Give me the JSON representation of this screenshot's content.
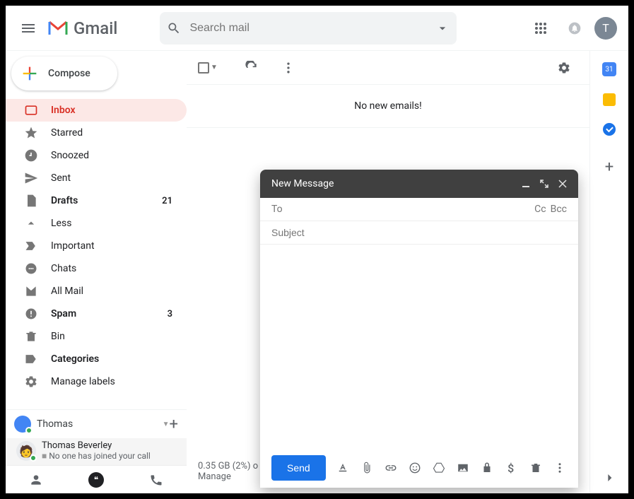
{
  "header": {
    "product_name": "Gmail",
    "search_placeholder": "Search mail",
    "avatar_letter": "T"
  },
  "compose_button": "Compose",
  "nav": [
    {
      "key": "inbox",
      "label": "Inbox",
      "badge": "",
      "bold": true,
      "active": true
    },
    {
      "key": "starred",
      "label": "Starred",
      "badge": "",
      "bold": false
    },
    {
      "key": "snoozed",
      "label": "Snoozed",
      "badge": "",
      "bold": false
    },
    {
      "key": "sent",
      "label": "Sent",
      "badge": "",
      "bold": false
    },
    {
      "key": "drafts",
      "label": "Drafts",
      "badge": "21",
      "bold": true
    },
    {
      "key": "less",
      "label": "Less",
      "badge": "",
      "bold": false
    },
    {
      "key": "important",
      "label": "Important",
      "badge": "",
      "bold": false
    },
    {
      "key": "chats",
      "label": "Chats",
      "badge": "",
      "bold": false
    },
    {
      "key": "allmail",
      "label": "All Mail",
      "badge": "",
      "bold": false
    },
    {
      "key": "spam",
      "label": "Spam",
      "badge": "3",
      "bold": true
    },
    {
      "key": "bin",
      "label": "Bin",
      "badge": "",
      "bold": false
    },
    {
      "key": "categories",
      "label": "Categories",
      "badge": "",
      "bold": true
    },
    {
      "key": "managelabels",
      "label": "Manage labels",
      "badge": "",
      "bold": false
    }
  ],
  "hangouts": {
    "user": "Thomas",
    "call_name": "Thomas Beverley",
    "call_status": "No one has joined your call"
  },
  "main": {
    "empty_text": "No new emails!",
    "storage_text": "0.35 GB (2%) o",
    "storage_manage": "Manage"
  },
  "rightpanel": {
    "calendar_date": "31"
  },
  "compose_window": {
    "title": "New Message",
    "to_label": "To",
    "cc_label": "Cc",
    "bcc_label": "Bcc",
    "subject_placeholder": "Subject",
    "send_label": "Send"
  }
}
